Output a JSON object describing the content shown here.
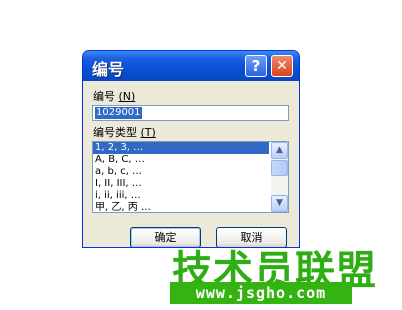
{
  "dialog": {
    "title": "编号",
    "help_glyph": "?",
    "close_glyph": "✕",
    "number_label": "编号",
    "number_hotkey": "(N)",
    "number_value": "1029001",
    "type_label": "编号类型",
    "type_hotkey": "(T)",
    "types": [
      "1, 2, 3, …",
      "A, B, C, …",
      "a, b, c, …",
      "I, II, III, …",
      "i, ii, iii, …",
      "甲, 乙, 丙 …"
    ],
    "selected_index": 0,
    "scroll_up_glyph": "▲",
    "scroll_down_glyph": "▼",
    "ok_label": "确定",
    "cancel_label": "取消"
  },
  "watermark": {
    "text": "技术员联盟",
    "url": "www.jsgho.com"
  },
  "colors": {
    "titlebar": "#0a4fd4",
    "selection": "#316ac5",
    "watermark": "#2fae13"
  }
}
